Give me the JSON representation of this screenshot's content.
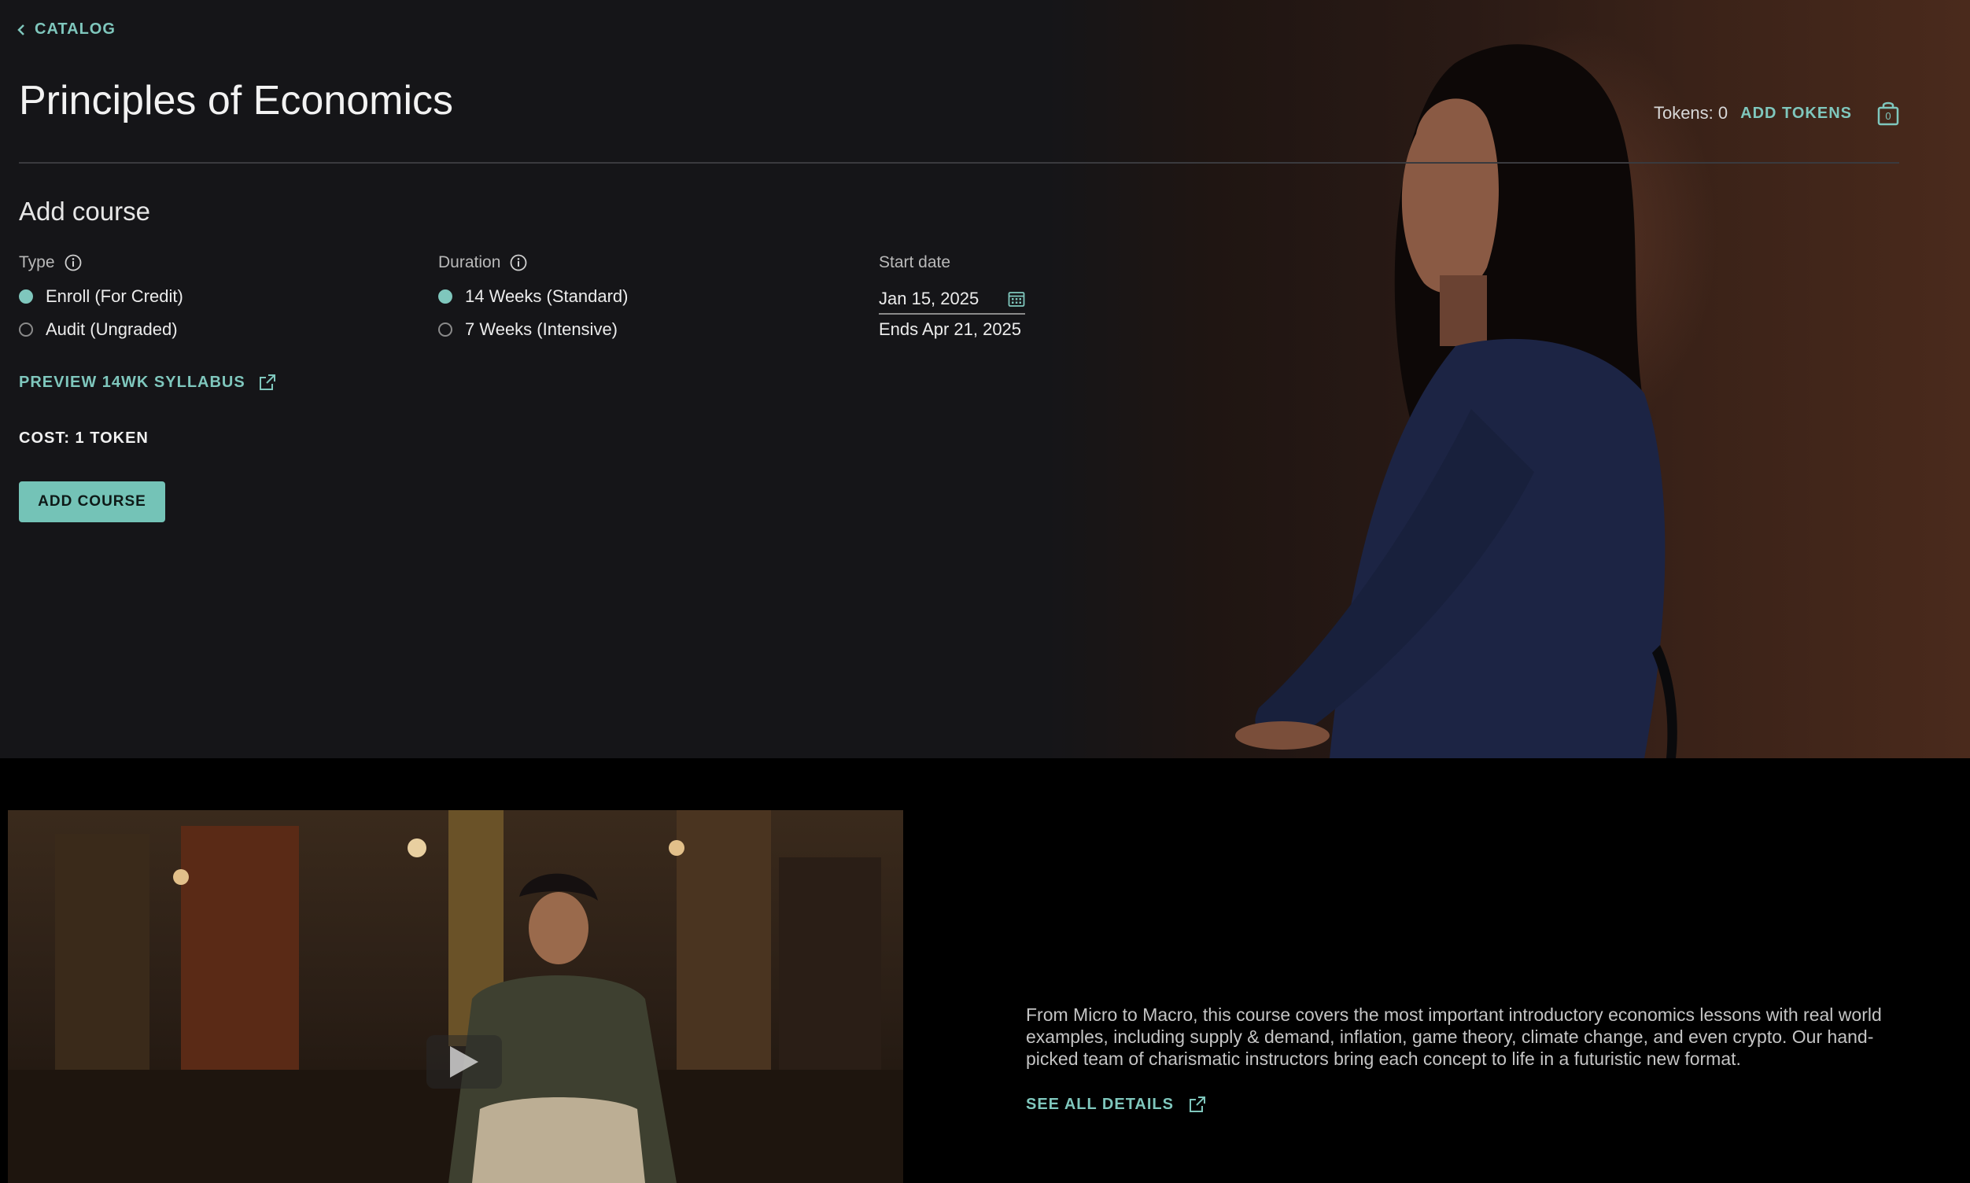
{
  "nav": {
    "back_label": "CATALOG"
  },
  "header": {
    "title": "Principles of Economics",
    "tokens_label": "Tokens: 0",
    "add_tokens_label": "ADD TOKENS",
    "cart_count": "0"
  },
  "form": {
    "section_title": "Add course",
    "type": {
      "label": "Type",
      "options": [
        {
          "label": "Enroll (For Credit)",
          "selected": true
        },
        {
          "label": "Audit (Ungraded)",
          "selected": false
        }
      ]
    },
    "duration": {
      "label": "Duration",
      "options": [
        {
          "label": "14 Weeks (Standard)",
          "selected": true
        },
        {
          "label": "7 Weeks (Intensive)",
          "selected": false
        }
      ]
    },
    "start_date": {
      "label": "Start date",
      "value": "Jan 15, 2025",
      "ends": "Ends Apr 21, 2025"
    },
    "preview_link": "PREVIEW 14WK SYLLABUS",
    "cost": "COST: 1 TOKEN",
    "add_button": "ADD COURSE"
  },
  "about": {
    "description": "From Micro to Macro, this course covers the most important introductory economics lessons with real world examples, including supply & demand, inflation, game theory, climate change, and even crypto. Our hand-picked team of charismatic instructors bring each concept to life in a futuristic new format.",
    "details_link": "SEE ALL DETAILS"
  },
  "colors": {
    "accent": "#7fc7bd",
    "background": "#151518",
    "button": "#74c3b7"
  }
}
